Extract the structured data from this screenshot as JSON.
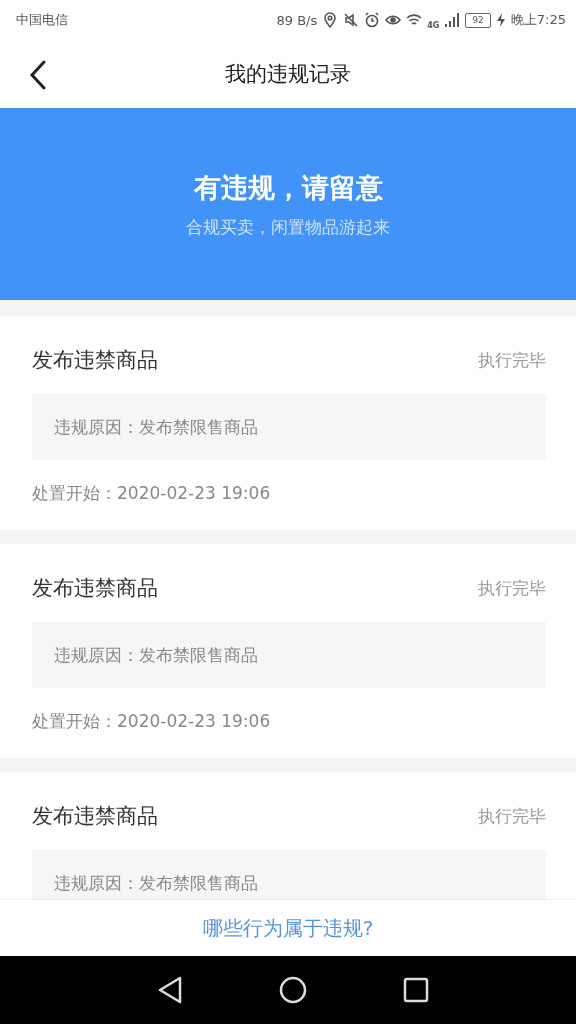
{
  "status_bar": {
    "carrier": "中国电信",
    "speed": "89 B/s",
    "network": "4G",
    "battery": "92",
    "time": "晚上7:25"
  },
  "nav": {
    "title": "我的违规记录"
  },
  "banner": {
    "title": "有违规，请留意",
    "subtitle": "合规买卖，闲置物品游起来"
  },
  "records": [
    {
      "title": "发布违禁商品",
      "status": "执行完毕",
      "reason": "违规原因：发布禁限售商品",
      "start": "处置开始：2020-02-23 19:06"
    },
    {
      "title": "发布违禁商品",
      "status": "执行完毕",
      "reason": "违规原因：发布禁限售商品",
      "start": "处置开始：2020-02-23 19:06"
    },
    {
      "title": "发布违禁商品",
      "status": "执行完毕",
      "reason": "违规原因：发布禁限售商品"
    }
  ],
  "footer_link": "哪些行为属于违规?"
}
